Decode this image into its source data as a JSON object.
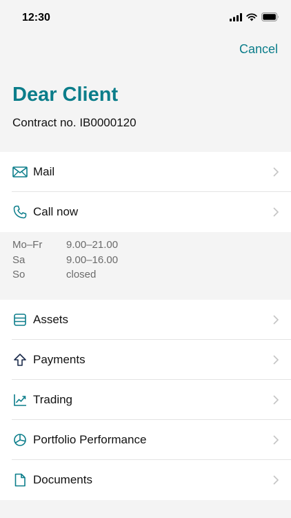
{
  "status": {
    "time": "12:30"
  },
  "header": {
    "cancel_label": "Cancel",
    "title": "Dear Client",
    "contract": "Contract no. IB0000120"
  },
  "contact": [
    {
      "label": "Mail",
      "icon": "mail-icon"
    },
    {
      "label": "Call now",
      "icon": "phone-icon"
    }
  ],
  "hours": [
    {
      "day": "Mo–Fr",
      "time": "9.00–21.00"
    },
    {
      "day": "Sa",
      "time": "9.00–16.00"
    },
    {
      "day": "So",
      "time": "closed"
    }
  ],
  "menu": [
    {
      "label": "Assets",
      "icon": "assets-icon"
    },
    {
      "label": "Payments",
      "icon": "arrow-up-icon"
    },
    {
      "label": "Trading",
      "icon": "chart-icon"
    },
    {
      "label": "Portfolio Performance",
      "icon": "pie-chart-icon"
    },
    {
      "label": "Documents",
      "icon": "document-icon"
    }
  ],
  "colors": {
    "accent": "#0b7d8a",
    "background": "#f4f4f4"
  }
}
